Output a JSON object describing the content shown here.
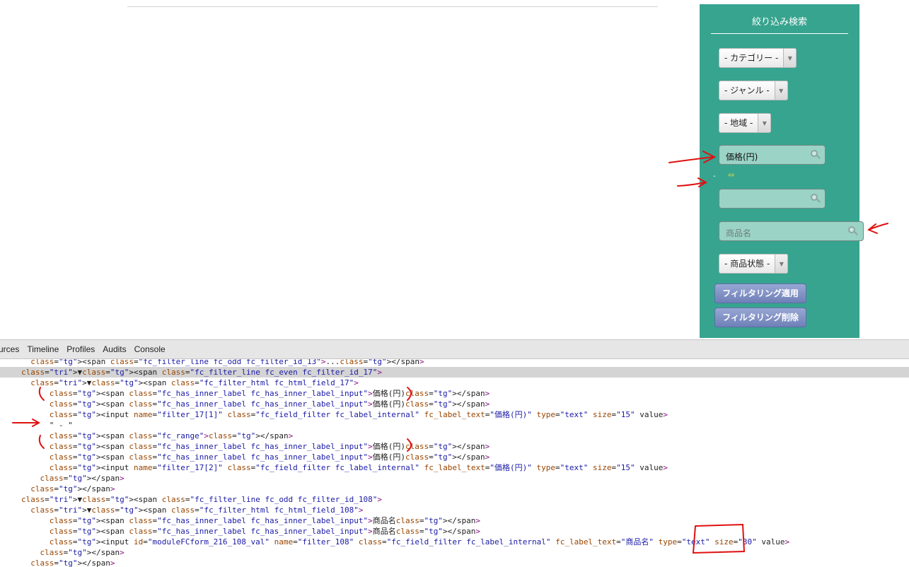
{
  "filter_panel": {
    "title": "絞り込み検索",
    "category_select": "- カテゴリー -",
    "genre_select": "- ジャンル -",
    "region_select": "- 地域 -",
    "price_from_label": "価格(円)",
    "range_separator": "-",
    "price_to_label": "",
    "product_name_label": "商品名",
    "condition_select": "- 商品状態 -",
    "apply_button": "フィルタリング適用",
    "clear_button": "フィルタリング削除"
  },
  "devtools": {
    "tabs": [
      "urces",
      "Timeline",
      "Profiles",
      "Audits",
      "Console"
    ],
    "lines": [
      "  <span class=\"fc_filter_line fc_odd fc_filter_id_13\">...</span>",
      "▼<span class=\"fc_filter_line fc_even fc_filter_id_17\">",
      "  ▼<span class=\"fc_filter_html fc_html_field_17\">",
      "      <span class=\"fc_has_inner_label fc_has_inner_label_input\">価格(円)</span>",
      "      <span class=\"fc_has_inner_label fc_has_inner_label_input\">価格(円)</span>",
      "      <input name=\"filter_17[1]\" class=\"fc_field_filter fc_label_internal\" fc_label_text=\"価格(円)\" type=\"text\" size=\"15\" value>",
      "      \" - \"",
      "      <span class=\"fc_range\"></span>",
      "      <span class=\"fc_has_inner_label fc_has_inner_label_input\">価格(円)</span>",
      "      <span class=\"fc_has_inner_label fc_has_inner_label_input\">価格(円)</span>",
      "      <input name=\"filter_17[2]\" class=\"fc_field_filter fc_label_internal\" fc_label_text=\"価格(円)\" type=\"text\" size=\"15\" value>",
      "    </span>",
      "  </span>",
      "▼<span class=\"fc_filter_line fc_odd fc_filter_id_108\">",
      "  ▼<span class=\"fc_filter_html fc_html_field_108\">",
      "      <span class=\"fc_has_inner_label fc_has_inner_label_input\">商品名</span>",
      "      <span class=\"fc_has_inner_label fc_has_inner_label_input\">商品名</span>",
      "      <input id=\"moduleFCform_216_108_val\" name=\"filter_108\" class=\"fc_field_filter fc_label_internal\" fc_label_text=\"商品名\" type=\"text\" size=\"30\" value>",
      "    </span>",
      "  </span>"
    ]
  }
}
